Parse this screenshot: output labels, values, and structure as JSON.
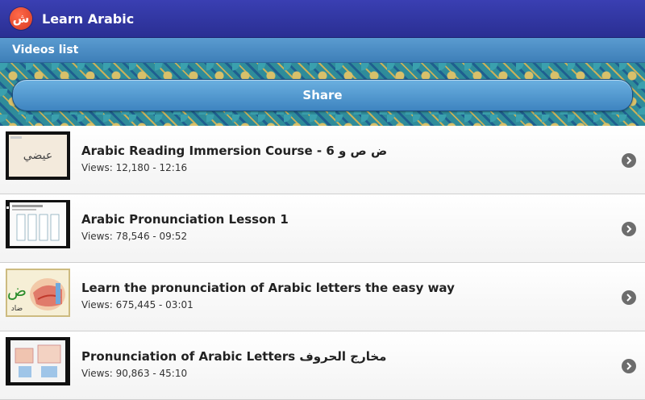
{
  "app": {
    "title": "Learn Arabic",
    "icon_glyph": "ش",
    "icon": "app-logo-icon"
  },
  "subbar": {
    "label": "Videos list"
  },
  "share": {
    "label": "Share"
  },
  "colors": {
    "titlebar": "#2d3298",
    "subbar": "#4a8bc4",
    "share_button": "#5a9fd4",
    "pattern_base": "#2b7e8c",
    "row_background": "#ffffff",
    "chevron": "#6d6d6d"
  },
  "videos": [
    {
      "title": "Arabic Reading Immersion Course - 6 ض ص و",
      "meta": "Views: 12,180 - 12:16"
    },
    {
      "title": "Arabic Pronunciation Lesson 1",
      "meta": "Views: 78,546 - 09:52"
    },
    {
      "title": "Learn the pronunciation of Arabic letters the easy way",
      "meta": "Views: 675,445 - 03:01"
    },
    {
      "title": "Pronunciation of Arabic Letters مخارج الحروف",
      "meta": "Views: 90,863 - 45:10"
    }
  ],
  "thumb_texts": {
    "t1_word": "عيضي",
    "t3_letter": "ض",
    "t3_word": "ضاد"
  }
}
